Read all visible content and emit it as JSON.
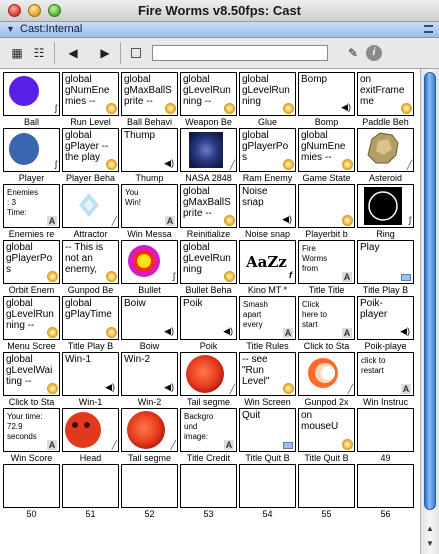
{
  "window": {
    "title": "Fire Worms v8.50fps: Cast"
  },
  "castbar": {
    "label": "Cast:Internal"
  },
  "toolbar": {
    "name_value": ""
  },
  "members": [
    {
      "num": 1,
      "label": "Ball",
      "type": "bitmap",
      "art": "purple-circle",
      "badge": "film"
    },
    {
      "num": 2,
      "label": "Run Level",
      "type": "script",
      "text": "global\ngNumEne\nmies --",
      "badge": "gear"
    },
    {
      "num": 3,
      "label": "Ball Behavi",
      "type": "script",
      "text": "global\ngMaxBallS\nprite --",
      "badge": "gear"
    },
    {
      "num": 4,
      "label": "Weapon Be",
      "type": "script",
      "text": "global\ngLevelRun\nning --",
      "badge": "gear"
    },
    {
      "num": 5,
      "label": "Glue",
      "type": "script",
      "text": "global\ngLevelRun\nning",
      "badge": "gear"
    },
    {
      "num": 6,
      "label": "Bomp",
      "type": "sound",
      "text": "Bomp",
      "badge": "speaker"
    },
    {
      "num": 7,
      "label": "Paddle Beh",
      "type": "script",
      "text": "on\nexitFrame\nme",
      "badge": "gear"
    },
    {
      "num": 8,
      "label": "Player",
      "type": "bitmap",
      "art": "blue-blob",
      "badge": "film"
    },
    {
      "num": 9,
      "label": "Player Beha",
      "type": "script",
      "text": "global\ngPlayer --\nthe play",
      "badge": "gear"
    },
    {
      "num": 10,
      "label": "Thump",
      "type": "sound",
      "text": "Thump",
      "badge": "speaker"
    },
    {
      "num": 11,
      "label": "NASA 2848",
      "type": "bitmap",
      "art": "nasa",
      "badge": "brush"
    },
    {
      "num": 12,
      "label": "Ram Enemy",
      "type": "script",
      "text": "global\ngPlayerPo\ns",
      "badge": "gear"
    },
    {
      "num": 13,
      "label": "Game State",
      "type": "script",
      "text": "global\ngNumEne\nmies --",
      "badge": "gear"
    },
    {
      "num": 14,
      "label": "Asteroid",
      "type": "bitmap",
      "art": "asteroid",
      "badge": "brush"
    },
    {
      "num": 15,
      "label": "Enemies re",
      "type": "text",
      "text": "Enemies\n: 3\nTime:",
      "badge": "A"
    },
    {
      "num": 16,
      "label": "Attractor",
      "type": "bitmap",
      "art": "attractor",
      "badge": "brush"
    },
    {
      "num": 17,
      "label": "Win Messa",
      "type": "text",
      "text": "You\nWin!",
      "badge": "A"
    },
    {
      "num": 18,
      "label": "Reinitialize",
      "type": "script",
      "text": "global\ngMaxBallS\nprite --",
      "badge": "gear"
    },
    {
      "num": 19,
      "label": "Noise snap",
      "type": "sound",
      "text": "Noise\nsnap",
      "badge": "speaker"
    },
    {
      "num": 20,
      "label": "Playerbit b",
      "type": "script",
      "text": "",
      "badge": "gear"
    },
    {
      "num": 21,
      "label": "Ring",
      "type": "bitmap",
      "art": "ring",
      "badge": "film"
    },
    {
      "num": 22,
      "label": "Orbit Enem",
      "type": "script",
      "text": "global\ngPlayerPo\ns",
      "badge": "gear"
    },
    {
      "num": 23,
      "label": "Gunpod Be",
      "type": "script",
      "text": "-- This is\nnot an\nenemy,",
      "badge": "gear"
    },
    {
      "num": 24,
      "label": "Bullet",
      "type": "bitmap",
      "art": "bullet",
      "badge": "film"
    },
    {
      "num": 25,
      "label": "Bullet Beha",
      "type": "script",
      "text": "global\ngLevelRun\nning",
      "badge": "gear"
    },
    {
      "num": 26,
      "label": "Kino MT *",
      "type": "font",
      "text": "AaZz",
      "badge": "f"
    },
    {
      "num": 27,
      "label": "Title Title",
      "type": "text",
      "text": "Fire\nWorms\nfrom",
      "badge": "A"
    },
    {
      "num": 28,
      "label": "Title Play B",
      "type": "button",
      "text": "Play",
      "badge": "button"
    },
    {
      "num": 29,
      "label": "Menu Scree",
      "type": "script",
      "text": "global\ngLevelRun\nning --",
      "badge": "gear"
    },
    {
      "num": 30,
      "label": "Title Play B",
      "type": "script",
      "text": "global\ngPlayTime",
      "badge": "gear"
    },
    {
      "num": 31,
      "label": "Boiw",
      "type": "sound",
      "text": "Boiw",
      "badge": "speaker"
    },
    {
      "num": 32,
      "label": "Poik",
      "type": "sound",
      "text": "Poik",
      "badge": "speaker"
    },
    {
      "num": 33,
      "label": "Title Rules",
      "type": "text",
      "text": "Smash\napart\nevery",
      "badge": "A"
    },
    {
      "num": 34,
      "label": "Click to Sta",
      "type": "text",
      "text": "Click\nhere to\nstart",
      "badge": "A"
    },
    {
      "num": 35,
      "label": "Poik-playe",
      "type": "sound",
      "text": "Poik-\nplayer",
      "badge": "speaker"
    },
    {
      "num": 36,
      "label": "Click to Sta",
      "type": "script",
      "text": "global\ngLevelWai\nting --",
      "badge": "gear"
    },
    {
      "num": 37,
      "label": "Win-1",
      "type": "sound",
      "text": "Win-1",
      "badge": "speaker"
    },
    {
      "num": 38,
      "label": "Win-2",
      "type": "sound",
      "text": "Win-2",
      "badge": "speaker"
    },
    {
      "num": 39,
      "label": "Tail segme",
      "type": "bitmap",
      "art": "orange-ball",
      "badge": "brush"
    },
    {
      "num": 40,
      "label": "Win Screen",
      "type": "script",
      "text": "-- see\n\"Run\nLevel\"",
      "badge": "gear"
    },
    {
      "num": 41,
      "label": "Gunpod 2x",
      "type": "bitmap",
      "art": "gunpod",
      "badge": "brush"
    },
    {
      "num": 42,
      "label": "Win Instruc",
      "type": "text",
      "text": "click to\nrestart",
      "badge": "A"
    },
    {
      "num": 43,
      "label": "Win Score",
      "type": "text",
      "text": "Your time:\n72.9\nseconds",
      "badge": "A"
    },
    {
      "num": 44,
      "label": "Head",
      "type": "bitmap",
      "art": "head",
      "badge": "brush"
    },
    {
      "num": 45,
      "label": "Tail segme",
      "type": "bitmap",
      "art": "orange-ball",
      "badge": "brush"
    },
    {
      "num": 46,
      "label": "Title Credit",
      "type": "text",
      "text": "Backgro\nund\nimage:",
      "badge": "A"
    },
    {
      "num": 47,
      "label": "Title Quit B",
      "type": "button",
      "text": "Quit",
      "badge": "button"
    },
    {
      "num": 48,
      "label": "Title Quit B",
      "type": "script",
      "text": "on\nmouseU",
      "badge": "gear"
    },
    {
      "num": 49,
      "label": "49",
      "type": "empty"
    },
    {
      "num": 50,
      "label": "50",
      "type": "empty"
    },
    {
      "num": 51,
      "label": "51",
      "type": "empty"
    },
    {
      "num": 52,
      "label": "52",
      "type": "empty"
    },
    {
      "num": 53,
      "label": "53",
      "type": "empty"
    },
    {
      "num": 54,
      "label": "54",
      "type": "empty"
    },
    {
      "num": 55,
      "label": "55",
      "type": "empty"
    },
    {
      "num": 56,
      "label": "56",
      "type": "empty"
    }
  ]
}
